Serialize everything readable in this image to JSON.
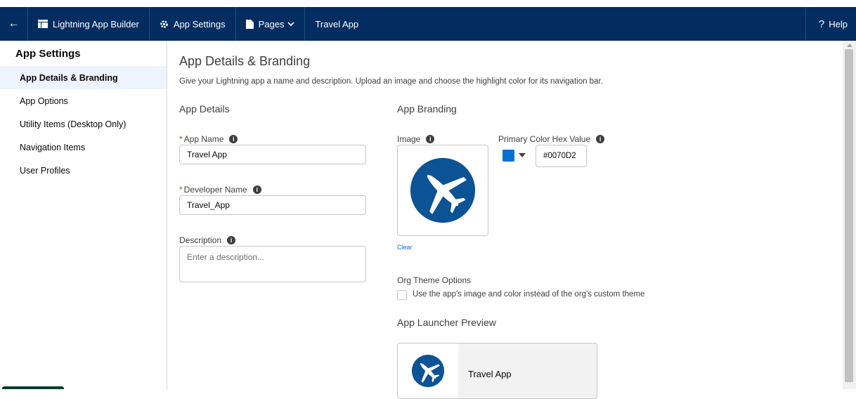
{
  "topbar": {
    "back_icon": "arrow-left-icon",
    "builder_label": "Lightning App Builder",
    "settings_label": "App Settings",
    "pages_label": "Pages",
    "app_name": "Travel App",
    "help_label": "Help"
  },
  "sidebar": {
    "title": "App Settings",
    "items": [
      {
        "label": "App Details & Branding",
        "active": true
      },
      {
        "label": "App Options"
      },
      {
        "label": "Utility Items (Desktop Only)"
      },
      {
        "label": "Navigation Items"
      },
      {
        "label": "User Profiles"
      }
    ]
  },
  "main": {
    "title": "App Details & Branding",
    "description": "Give your Lightning app a name and description. Upload an image and choose the highlight color for its navigation bar.",
    "details": {
      "heading": "App Details",
      "app_name_label": "App Name",
      "app_name_value": "Travel App",
      "developer_name_label": "Developer Name",
      "developer_name_value": "Travel_App",
      "description_label": "Description",
      "description_placeholder": "Enter a description..."
    },
    "branding": {
      "heading": "App Branding",
      "image_label": "Image",
      "clear_label": "Clear",
      "color_label": "Primary Color Hex Value",
      "color_value": "#0070D2",
      "org_theme_label": "Org Theme Options",
      "org_theme_checkbox_label": "Use the app's image and color instead of the org's custom theme",
      "org_theme_checked": false
    },
    "preview": {
      "heading": "App Launcher Preview",
      "app_name": "Travel App"
    }
  },
  "colors": {
    "topbar_bg": "#032d60",
    "brand_blue": "#0070d2",
    "icon_blue": "#0b5394",
    "active_item_bg": "#eef4ff",
    "required": "#c23934"
  }
}
